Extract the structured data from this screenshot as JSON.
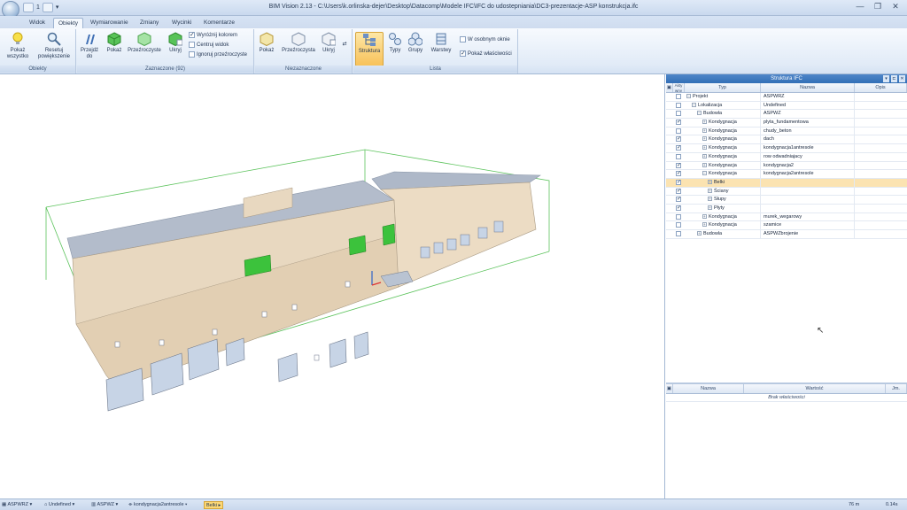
{
  "window": {
    "title": "BIM Vision 2.13 - C:\\Users\\k.orlinska-dejer\\Desktop\\Datacomp\\Modele IFC\\IFC do udostepniania\\DC3-prezentacje-ASP konstrukcja.ifc",
    "qat_value": "1",
    "minimize": "—",
    "maximize": "❐",
    "close": "✕"
  },
  "tabs": [
    {
      "label": "Widok"
    },
    {
      "label": "Obiekty"
    },
    {
      "label": "Wymiarowanie"
    },
    {
      "label": "Zmiany"
    },
    {
      "label": "Wycinki"
    },
    {
      "label": "Komentarze"
    }
  ],
  "ribbon": {
    "groups": [
      {
        "label": "Obiekty"
      },
      {
        "label": "Zaznaczone (92)"
      },
      {
        "label": "Niezaznaczone"
      },
      {
        "label": "Lista"
      }
    ],
    "buttons": [
      {
        "label": "Pokaż wszystko",
        "icon": "bulb-icon"
      },
      {
        "label": "Resetuj powiększenie",
        "icon": "magnifier-icon"
      },
      {
        "label": "Przejdź do",
        "icon": "goto-icon"
      },
      {
        "label": "Pokaż",
        "icon": "cube-show-icon"
      },
      {
        "label": "Przeźroczyste",
        "icon": "cube-transparent-icon"
      },
      {
        "label": "Ukryj",
        "icon": "cube-hide-icon"
      },
      {
        "label": "Pokaż",
        "icon": "cube-show-icon"
      },
      {
        "label": "Przeźroczysta",
        "icon": "cube-transparent-icon"
      },
      {
        "label": "Ukryj",
        "icon": "cube-hide-icon"
      },
      {
        "label": "Struktura",
        "icon": "structure-icon"
      },
      {
        "label": "Typy",
        "icon": "types-icon"
      },
      {
        "label": "Grupy",
        "icon": "groups-icon"
      },
      {
        "label": "Warstwy",
        "icon": "layers-icon"
      }
    ],
    "selected_checks": [
      {
        "label": "Wyróżnij kolorem",
        "checked": true
      },
      {
        "label": "Centruj widok",
        "checked": false
      },
      {
        "label": "Ignoruj przeźroczyste",
        "checked": false
      }
    ],
    "list_checks": [
      {
        "label": "W osobnym oknie",
        "checked": false
      },
      {
        "label": "Pokaż właściwości",
        "checked": true
      }
    ]
  },
  "structure_panel": {
    "title": "Struktura IFC",
    "columns": [
      "Akty wny",
      "Typ",
      "Nazwa",
      "Opis"
    ],
    "rows": [
      {
        "checked": false,
        "type": "Projekt",
        "name": "ASPWRZ",
        "expander": "−",
        "selected": false
      },
      {
        "checked": false,
        "type": "Lokalizacja",
        "name": "Undefined",
        "expander": "−",
        "selected": false
      },
      {
        "checked": false,
        "type": "Budowla",
        "name": "ASPWZ",
        "expander": "−",
        "selected": false
      },
      {
        "checked": true,
        "type": "Kondygnacja",
        "name": "plyta_fundamentowa",
        "expander": "+",
        "selected": false
      },
      {
        "checked": false,
        "type": "Kondygnacja",
        "name": "chudy_beton",
        "expander": "+",
        "selected": false
      },
      {
        "checked": true,
        "type": "Kondygnacja",
        "name": "dach",
        "expander": "+",
        "selected": false
      },
      {
        "checked": true,
        "type": "Kondygnacja",
        "name": "kondygnacja1antresole",
        "expander": "+",
        "selected": false
      },
      {
        "checked": false,
        "type": "Kondygnacja",
        "name": "row odwadniajacy",
        "expander": "+",
        "selected": false
      },
      {
        "checked": true,
        "type": "Kondygnacja",
        "name": "kondygnacja2",
        "expander": "+",
        "selected": false
      },
      {
        "checked": true,
        "type": "Kondygnacja",
        "name": "kondygnacja2antresole",
        "expander": "−",
        "selected": false
      },
      {
        "checked": true,
        "type": "Belki",
        "name": "",
        "expander": "+",
        "selected": true
      },
      {
        "checked": true,
        "type": "Ściany",
        "name": "",
        "expander": "+",
        "selected": false
      },
      {
        "checked": true,
        "type": "Słupy",
        "name": "",
        "expander": "+",
        "selected": false
      },
      {
        "checked": true,
        "type": "Płyty",
        "name": "",
        "expander": "+",
        "selected": false
      },
      {
        "checked": false,
        "type": "Kondygnacja",
        "name": "murek_wegarowy",
        "expander": "+",
        "selected": false
      },
      {
        "checked": false,
        "type": "Kondygnacja",
        "name": "szamice",
        "expander": "+",
        "selected": false
      },
      {
        "checked": false,
        "type": "Budowla",
        "name": "ASPWZbrojenie",
        "expander": "+",
        "selected": false
      }
    ]
  },
  "properties_panel": {
    "columns": [
      "Nazwa",
      "Wartość",
      "Jm."
    ],
    "empty_text": "Brak właściwości"
  },
  "statusbar": {
    "crumbs": [
      "ASPWRZ",
      "Undefined",
      "ASPWZ",
      "kondygnacja2antresole",
      "Belki"
    ],
    "right1": "76 m",
    "right2": "0.14s"
  },
  "colors": {
    "accent": "#336fb6",
    "selection": "#fbd776",
    "highlight_green": "#3cc23c",
    "wall": "#e8d6bd",
    "roof": "#aeb8c8"
  }
}
